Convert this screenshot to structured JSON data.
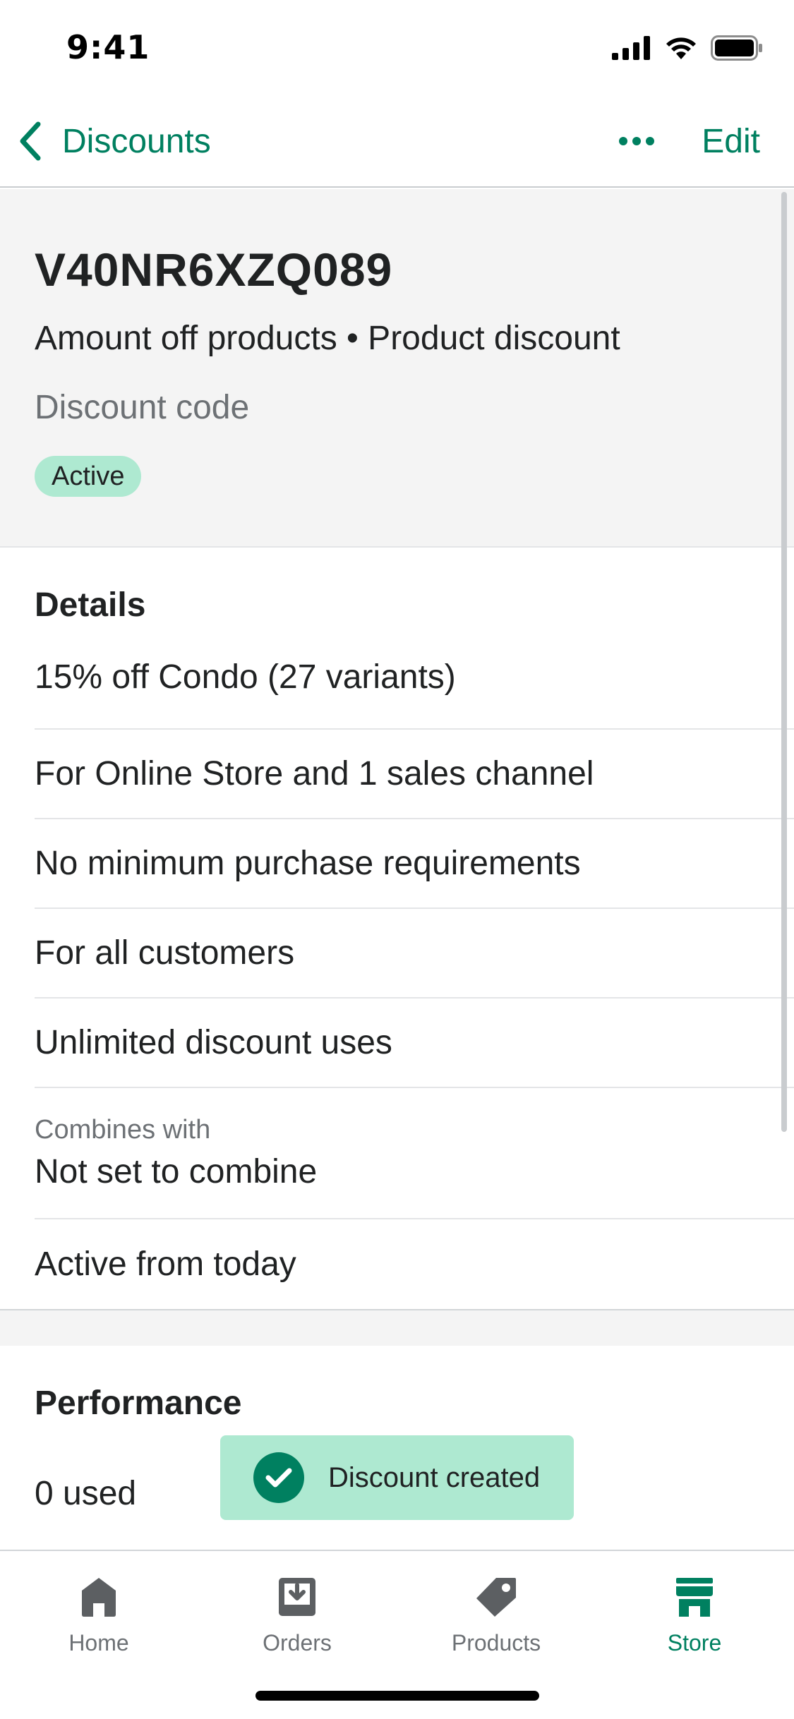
{
  "status_bar": {
    "time": "9:41"
  },
  "nav": {
    "back_label": "Discounts",
    "edit_label": "Edit",
    "more_icon": "ellipsis-icon"
  },
  "discount": {
    "code": "V40NR6XZQ089",
    "type_line": "Amount off products • Product discount",
    "method": "Discount code",
    "status": "Active"
  },
  "details": {
    "title": "Details",
    "rows": [
      "15% off Condo (27 variants)",
      "For Online Store and 1 sales channel",
      "No minimum purchase requirements",
      "For all customers",
      "Unlimited discount uses"
    ],
    "combines_caption": "Combines with",
    "combines_value": "Not set to combine",
    "active_from": "Active from today"
  },
  "performance": {
    "title": "Performance",
    "used": "0 used"
  },
  "toast": {
    "message": "Discount created"
  },
  "tabs": [
    {
      "label": "Home",
      "icon": "home-icon"
    },
    {
      "label": "Orders",
      "icon": "orders-icon"
    },
    {
      "label": "Products",
      "icon": "tag-icon"
    },
    {
      "label": "Store",
      "icon": "store-icon",
      "active": true
    }
  ],
  "colors": {
    "accent": "#008060",
    "badge_bg": "#aee9d1",
    "text": "#202223",
    "subdued": "#6d7175",
    "tab_inactive": "#5c5f62"
  }
}
